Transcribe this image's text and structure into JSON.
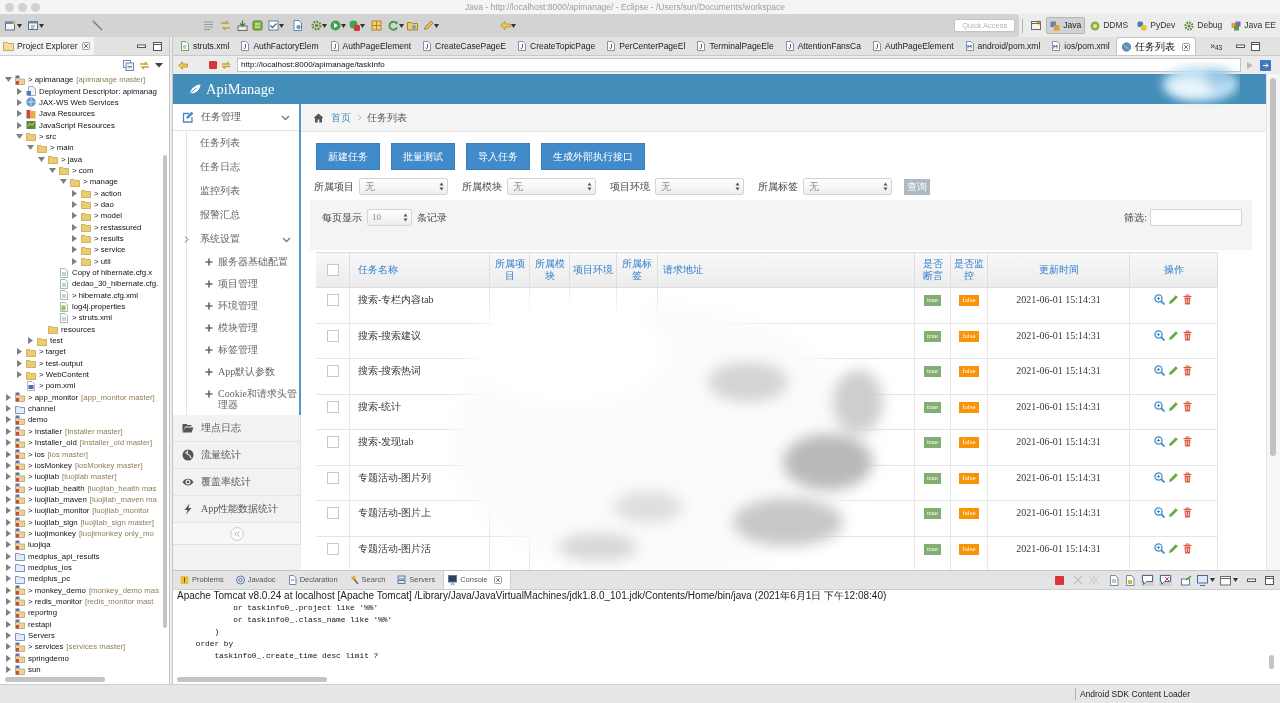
{
  "window": {
    "title": "Java - http://localhost:8000/apimanage/ - Eclipse - /Users/sun/Documents/workspace"
  },
  "toolbar": {
    "quick_access": {
      "placeholder": "Quick Access"
    },
    "perspectives": [
      {
        "label": "Java",
        "selected": true
      },
      {
        "label": "DDMS",
        "selected": false
      },
      {
        "label": "PyDev",
        "selected": false
      },
      {
        "label": "Debug",
        "selected": false
      },
      {
        "label": "Java EE",
        "selected": false
      }
    ]
  },
  "project_explorer": {
    "title": "Project Explorer",
    "tree": [
      {
        "label": "> apimanage",
        "decoration": "[apimanage master]",
        "kind": "project",
        "expanded": true,
        "children": [
          {
            "label": "Deployment Descriptor: apimanag",
            "kind": "descriptor",
            "expanded": false
          },
          {
            "label": "JAX-WS Web Services",
            "kind": "services",
            "expanded": false
          },
          {
            "label": "Java Resources",
            "kind": "library",
            "expanded": false
          },
          {
            "label": "JavaScript Resources",
            "kind": "script",
            "expanded": false
          },
          {
            "label": "> src",
            "kind": "folder",
            "expanded": true,
            "children": [
              {
                "label": "> main",
                "kind": "folder",
                "expanded": true,
                "children": [
                  {
                    "label": "> java",
                    "kind": "folder",
                    "expanded": true,
                    "children": [
                      {
                        "label": "> com",
                        "kind": "folder",
                        "expanded": true,
                        "children": [
                          {
                            "label": "> manage",
                            "kind": "folder",
                            "expanded": true,
                            "children": [
                              {
                                "label": "> action",
                                "kind": "folder",
                                "expanded": false
                              },
                              {
                                "label": "> dao",
                                "kind": "folder",
                                "expanded": false
                              },
                              {
                                "label": "> model",
                                "kind": "folder",
                                "expanded": false
                              },
                              {
                                "label": "> restassured",
                                "kind": "folder",
                                "expanded": false
                              },
                              {
                                "label": "> results",
                                "kind": "folder",
                                "expanded": false
                              },
                              {
                                "label": "> service",
                                "kind": "folder",
                                "expanded": false
                              },
                              {
                                "label": "> util",
                                "kind": "folder",
                                "expanded": false
                              }
                            ]
                          }
                        ]
                      },
                      {
                        "label": "Copy of hibernate.cfg.x",
                        "kind": "file"
                      },
                      {
                        "label": "dedao_30_hibernate.cfg.",
                        "kind": "file"
                      },
                      {
                        "label": "> hibernate.cfg.xml",
                        "kind": "file"
                      },
                      {
                        "label": "log4j.properties",
                        "kind": "properties"
                      },
                      {
                        "label": "> struts.xml",
                        "kind": "file"
                      }
                    ]
                  },
                  {
                    "label": "resources",
                    "kind": "folder"
                  }
                ]
              },
              {
                "label": "test",
                "kind": "folder",
                "expanded": false
              }
            ]
          },
          {
            "label": "> target",
            "kind": "folder",
            "expanded": false
          },
          {
            "label": "> test-output",
            "kind": "folder",
            "expanded": false
          },
          {
            "label": "> WebContent",
            "kind": "folder",
            "expanded": false
          },
          {
            "label": "> pom.xml",
            "kind": "pom"
          }
        ]
      },
      {
        "label": "> app_monitor",
        "decoration": "[app_monitor master]",
        "kind": "project",
        "expanded": false
      },
      {
        "label": "channel",
        "kind": "closed",
        "expanded": false
      },
      {
        "label": "demo",
        "kind": "project",
        "expanded": false
      },
      {
        "label": "> Installer",
        "decoration": "[Installer master]",
        "kind": "project",
        "expanded": false
      },
      {
        "label": "> Installer_old",
        "decoration": "[Installer_old master]",
        "kind": "project",
        "expanded": false
      },
      {
        "label": "> ios",
        "decoration": "[ios master]",
        "kind": "project",
        "expanded": false
      },
      {
        "label": "> iosMonkey",
        "decoration": "[iosMonkey master]",
        "kind": "project",
        "expanded": false
      },
      {
        "label": "> luojilab",
        "decoration": "[luojilab master]",
        "kind": "project",
        "expanded": false
      },
      {
        "label": "> luojilab_health",
        "decoration": "[luojilab_health mas",
        "kind": "project",
        "expanded": false
      },
      {
        "label": "> luojilab_maven",
        "decoration": "[luojilab_maven ma",
        "kind": "project",
        "expanded": false
      },
      {
        "label": "> luojilab_monitor",
        "decoration": "[luojilab_monitor",
        "kind": "project",
        "expanded": false
      },
      {
        "label": "> luojilab_sign",
        "decoration": "[luojilab_sign master]",
        "kind": "project",
        "expanded": false
      },
      {
        "label": "> luojimonkey",
        "decoration": "[luojimonkey only_mo",
        "kind": "project",
        "expanded": false
      },
      {
        "label": "luojiqa",
        "kind": "project",
        "expanded": false
      },
      {
        "label": "medplus_api_results",
        "kind": "closed",
        "expanded": false
      },
      {
        "label": "medplus_ios",
        "kind": "closed",
        "expanded": false
      },
      {
        "label": "medplus_pc",
        "kind": "closed",
        "expanded": false
      },
      {
        "label": "> monkey_demo",
        "decoration": "[monkey_demo mas",
        "kind": "project",
        "expanded": false
      },
      {
        "label": "> redis_monitor",
        "decoration": "[redis_monitor mast",
        "kind": "project",
        "expanded": false
      },
      {
        "label": "reportng",
        "kind": "project",
        "expanded": false
      },
      {
        "label": "restapi",
        "kind": "project",
        "expanded": false
      },
      {
        "label": "Servers",
        "kind": "closed",
        "expanded": false
      },
      {
        "label": "> services",
        "decoration": "[services master]",
        "kind": "project",
        "expanded": false
      },
      {
        "label": "springdemo",
        "kind": "project",
        "expanded": false
      },
      {
        "label": "sun",
        "kind": "project",
        "expanded": false
      }
    ]
  },
  "editor": {
    "tabs": [
      {
        "label": "struts.xml",
        "kind": "xml",
        "selected": false
      },
      {
        "label": "AuthFactoryElem",
        "kind": "java",
        "selected": false
      },
      {
        "label": "AuthPageElement",
        "kind": "java",
        "selected": false
      },
      {
        "label": "CreateCasePageE",
        "kind": "java",
        "selected": false
      },
      {
        "label": "CreateTopicPage",
        "kind": "java",
        "selected": false
      },
      {
        "label": "PerCenterPageEl",
        "kind": "java",
        "selected": false
      },
      {
        "label": "TerminalPageEle",
        "kind": "java",
        "selected": false
      },
      {
        "label": "AttentionFansCa",
        "kind": "java",
        "selected": false
      },
      {
        "label": "AuthPageElement",
        "kind": "java",
        "selected": false
      },
      {
        "label": "android/pom.xml",
        "kind": "maven",
        "selected": false
      },
      {
        "label": "ios/pom.xml",
        "kind": "maven",
        "selected": false
      },
      {
        "label": "任务列表",
        "kind": "web",
        "selected": true
      }
    ],
    "more_tabs": "»$_{43}$"
  },
  "browser": {
    "url": "http://localhost:8000/apimanage/taskInfo"
  },
  "app": {
    "logo": "ApiManage",
    "sidebar": [
      {
        "label": "任务管理",
        "expanded": true,
        "children": [
          {
            "label": "任务列表"
          },
          {
            "label": "任务日志"
          },
          {
            "label": "监控列表"
          },
          {
            "label": "报警汇总"
          },
          {
            "label": "系统设置",
            "expanded": true,
            "children": [
              {
                "label": "服务器基础配置"
              },
              {
                "label": "项目管理"
              },
              {
                "label": "环境管理"
              },
              {
                "label": "模块管理"
              },
              {
                "label": "标签管理"
              },
              {
                "label": "App默认参数"
              },
              {
                "label": "Cookie和请求头管理器"
              }
            ]
          }
        ]
      },
      {
        "label": "埋点日志"
      },
      {
        "label": "流量统计"
      },
      {
        "label": "覆盖率统计"
      },
      {
        "label": "App性能数据统计"
      }
    ],
    "breadcrumb": [
      "首页",
      "任务列表"
    ],
    "actions": [
      "新建任务",
      "批量测试",
      "导入任务",
      "生成外部执行接口"
    ],
    "filters": [
      {
        "label": "所属项目",
        "value": "无"
      },
      {
        "label": "所属模块",
        "value": "无"
      },
      {
        "label": "项目环境",
        "value": "无"
      },
      {
        "label": "所属标签",
        "value": "无"
      }
    ],
    "query_button": "查询",
    "page_size": {
      "before": "每页显示",
      "value": "10",
      "after": "条记录"
    },
    "search": {
      "label": "筛选:"
    },
    "table": {
      "header_checked": false,
      "columns": [
        "任务名称",
        "所属项目",
        "所属模块",
        "项目环境",
        "所属标签",
        "请求地址",
        "是否断言",
        "是否监控",
        "更新时间",
        "操作"
      ],
      "rows": [
        {
          "checked": false,
          "name": "搜索-专栏内容tab",
          "assertion": {
            "label": "true",
            "on": true
          },
          "monitoring": {
            "label": "false",
            "on": false
          },
          "updated": "2021-06-01 15:14:31"
        },
        {
          "checked": false,
          "name": "搜索-搜索建议",
          "assertion": {
            "label": "true",
            "on": true
          },
          "monitoring": {
            "label": "false",
            "on": false
          },
          "updated": "2021-06-01 15:14:31"
        },
        {
          "checked": false,
          "name": "搜索-搜索热词",
          "assertion": {
            "label": "true",
            "on": true
          },
          "monitoring": {
            "label": "false",
            "on": false
          },
          "updated": "2021-06-01 15:14:31"
        },
        {
          "checked": false,
          "name": "搜索-统计",
          "assertion": {
            "label": "true",
            "on": true
          },
          "monitoring": {
            "label": "false",
            "on": false
          },
          "updated": "2021-06-01 15:14:31"
        },
        {
          "checked": false,
          "name": "搜索-发现tab",
          "assertion": {
            "label": "true",
            "on": true
          },
          "monitoring": {
            "label": "false",
            "on": false
          },
          "updated": "2021-06-01 15:14:31"
        },
        {
          "checked": false,
          "name": "专题活动-图片列",
          "assertion": {
            "label": "true",
            "on": true
          },
          "monitoring": {
            "label": "false",
            "on": false
          },
          "updated": "2021-06-01 15:14:31"
        },
        {
          "checked": false,
          "name": "专题活动-图片上",
          "assertion": {
            "label": "true",
            "on": true
          },
          "monitoring": {
            "label": "false",
            "on": false
          },
          "updated": "2021-06-01 15:14:31"
        },
        {
          "checked": false,
          "name": "专题活动-图片活",
          "assertion": {
            "label": "true",
            "on": true
          },
          "monitoring": {
            "label": "false",
            "on": false
          },
          "updated": "2021-06-01 15:14:31"
        }
      ]
    }
  },
  "console": {
    "tabs": [
      {
        "label": "Problems",
        "selected": false
      },
      {
        "label": "Javadoc",
        "selected": false
      },
      {
        "label": "Declaration",
        "selected": false
      },
      {
        "label": "Search",
        "selected": false
      },
      {
        "label": "Servers",
        "selected": false
      },
      {
        "label": "Console",
        "selected": true
      }
    ],
    "header": "Apache Tomcat v8.0.24 at localhost [Apache Tomcat] /Library/Java/JavaVirtualMachines/jdk1.8.0_101.jdk/Contents/Home/bin/java (2021年6月1日 下午12:08:40)",
    "lines": [
      "            or taskinfo0_.project like '%%'",
      "            or taskinfo0_.class_name like '%%'",
      "        )",
      "    order by",
      "        taskinfo0_.create_time desc limit ?"
    ]
  },
  "status_bar": {
    "task": "Android SDK Content Loader"
  }
}
